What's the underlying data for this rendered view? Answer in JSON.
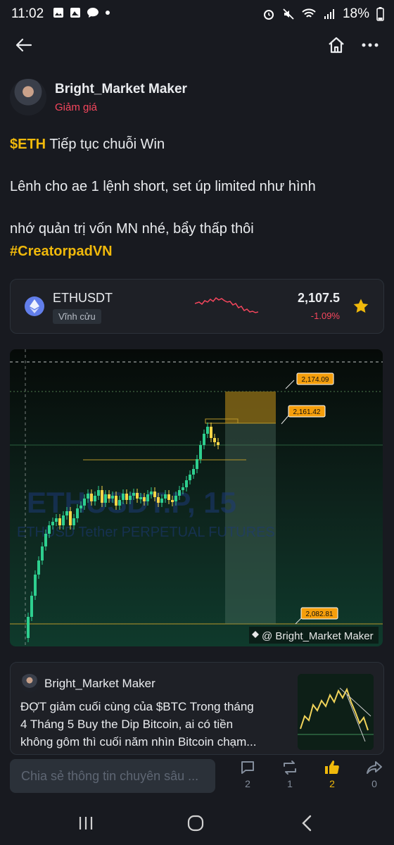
{
  "status": {
    "time": "11:02",
    "battery": "18%"
  },
  "post": {
    "author": "Bright_Market Maker",
    "sentiment": "Giảm giá",
    "line1_tag": "$ETH",
    "line1_text": " Tiếp tục chuỗi Win",
    "line2": "Lênh cho ae 1 lệnh short, set úp limited như hình",
    "line3": "nhớ quản trị vốn MN nhé, bẩy thấp thôi",
    "hashtag": "#CreatorpadVN"
  },
  "ticker": {
    "symbol": "ETHUSDT",
    "type": "Vĩnh cửu",
    "price": "2,107.5",
    "change": "-1.09%",
    "colors": {
      "down": "#f6465d",
      "star": "#f0b90b"
    }
  },
  "chart_image": {
    "watermark_title": "ETHUSDT.P, 15",
    "watermark_sub": "ETHUSD Tether PERPETUAL FUTURES",
    "label_top": "2,174.09",
    "label_mid": "2,161.42",
    "label_bottom": "2,082.81",
    "credit": "@ Bright_Market Maker"
  },
  "related": {
    "author": "Bright_Market Maker",
    "text_line1": "ĐỢT giảm cuối cùng của $BTC Trong tháng",
    "text_line2": "4 Tháng 5 Buy the Dip Bitcoin, ai có tiền",
    "text_line3": "không gôm thì cuối năm nhìn Bitcoin chạm..."
  },
  "bottom": {
    "share_placeholder": "Chia sẻ thông tin chuyên sâu ...",
    "comments": "2",
    "reposts": "1",
    "likes": "2",
    "shares": "0"
  }
}
